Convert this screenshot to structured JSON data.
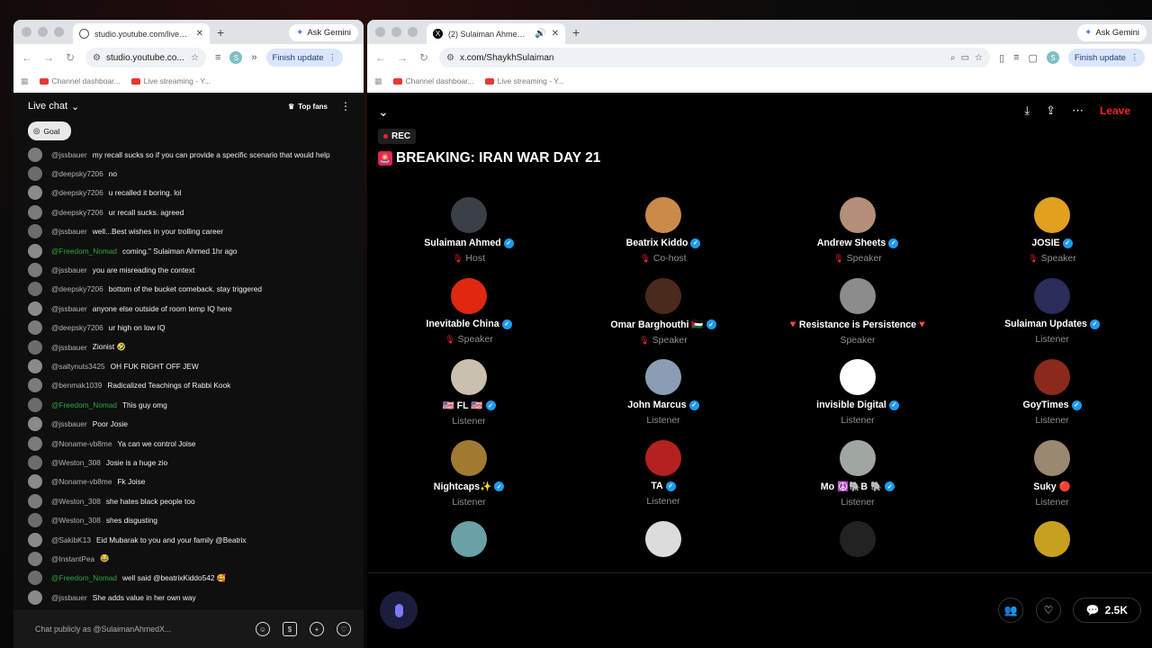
{
  "left_window": {
    "tab_title": "studio.youtube.com/live_chat",
    "gemini": "Ask Gemini",
    "url": "studio.youtube.co...",
    "finish_update": "Finish update",
    "bookmarks": [
      "Channel dashboar...",
      "Live streaming - Y..."
    ],
    "chat": {
      "title": "Live chat",
      "top_fans": "Top fans",
      "goal": "Goal",
      "input_placeholder": "Chat publicly as @SulaimanAhmedX...",
      "messages": [
        {
          "author": "@jssbauer",
          "text": "my recall sucks so if you can provide a specific scenario that would help",
          "member": false
        },
        {
          "author": "@deepsky7206",
          "text": "no",
          "member": false
        },
        {
          "author": "@deepsky7206",
          "text": "u recalled it boring. lol",
          "member": false
        },
        {
          "author": "@deepsky7206",
          "text": "ur recall sucks. agreed",
          "member": false
        },
        {
          "author": "@jssbauer",
          "text": "well...Best wishes in your trolling career",
          "member": false
        },
        {
          "author": "@Freedom_Nomad",
          "text": "coming.\" Sulaiman Ahmed 1hr ago",
          "member": true
        },
        {
          "author": "@jssbauer",
          "text": "you are misreading the context",
          "member": false
        },
        {
          "author": "@deepsky7206",
          "text": "bottom of the bucket comeback. stay triggered",
          "member": false
        },
        {
          "author": "@jssbauer",
          "text": "anyone else outside of room temp IQ here",
          "member": false
        },
        {
          "author": "@deepsky7206",
          "text": "ur high on low IQ",
          "member": false
        },
        {
          "author": "@jssbauer",
          "text": "Zionist 🤣",
          "member": false
        },
        {
          "author": "@saltynuts3425",
          "text": "OH FUK RIGHT OFF JEW",
          "member": false
        },
        {
          "author": "@benmak1039",
          "text": "Radicalized Teachings of Rabbi Kook",
          "member": false
        },
        {
          "author": "@Freedom_Nomad",
          "text": "This guy omg",
          "member": true
        },
        {
          "author": "@jssbauer",
          "text": "Poor Josie",
          "member": false
        },
        {
          "author": "@Noname-vb8me",
          "text": "Ya can we control Joise",
          "member": false
        },
        {
          "author": "@Weston_308",
          "text": "Josie is a huge zio",
          "member": false
        },
        {
          "author": "@Noname-vb8me",
          "text": "Fk Joise",
          "member": false
        },
        {
          "author": "@Weston_308",
          "text": "she hates black people too",
          "member": false
        },
        {
          "author": "@Weston_308",
          "text": "shes disgusting",
          "member": false
        },
        {
          "author": "@SakibK13",
          "text": "Eid Mubarak to you and your family @Beatrix",
          "member": false
        },
        {
          "author": "@InstantPea",
          "text": "😂",
          "member": false
        },
        {
          "author": "@Freedom_Nomad",
          "text": "well said @beatrixKiddo542 🥰",
          "member": true
        },
        {
          "author": "@jssbauer",
          "text": "She adds value in her own way",
          "member": false
        }
      ]
    }
  },
  "right_window": {
    "tab_title": "(2) Sulaiman Ahmed (@S...",
    "gemini": "Ask Gemini",
    "url": "x.com/ShaykhSulaiman",
    "finish_update": "Finish update",
    "bookmarks": [
      "Channel dashboar...",
      "Live streaming - Y..."
    ],
    "space": {
      "leave": "Leave",
      "rec": "REC",
      "title": "BREAKING: IRAN WAR DAY 21",
      "replies": "2.5K",
      "participants": [
        {
          "name": "Sulaiman Ahmed",
          "role": "Host",
          "verified": true,
          "muted": true,
          "color": "#3a3f48"
        },
        {
          "name": "Beatrix Kiddo",
          "role": "Co-host",
          "verified": true,
          "muted": true,
          "color": "#c98a4a"
        },
        {
          "name": "Andrew Sheets",
          "role": "Speaker",
          "verified": true,
          "muted": true,
          "color": "#b48f7a"
        },
        {
          "name": "JOSIE",
          "role": "Speaker",
          "verified": true,
          "muted": true,
          "color": "#e0a020"
        },
        {
          "name": "Inevitable China",
          "role": "Speaker",
          "verified": true,
          "muted": true,
          "color": "#de2910"
        },
        {
          "name": "Omar Barghouthi 🇵🇸",
          "role": "Speaker",
          "verified": true,
          "muted": true,
          "color": "#4a2a1a"
        },
        {
          "name": "🔻Resistance is Persistence🔻",
          "role": "Speaker",
          "verified": false,
          "muted": false,
          "color": "#8c8c8c"
        },
        {
          "name": "Sulaiman Updates",
          "role": "Listener",
          "verified": true,
          "muted": false,
          "color": "#2a2d5a"
        },
        {
          "name": "🇺🇸 FL 🇺🇸",
          "role": "Listener",
          "verified": true,
          "muted": false,
          "color": "#c9c0b0"
        },
        {
          "name": "John Marcus",
          "role": "Listener",
          "verified": true,
          "muted": false,
          "color": "#8a9db5"
        },
        {
          "name": "invisible Digital",
          "role": "Listener",
          "verified": true,
          "muted": false,
          "color": "#ffffff"
        },
        {
          "name": "GoyTimes",
          "role": "Listener",
          "verified": true,
          "muted": false,
          "color": "#8a2a1a"
        },
        {
          "name": "Nightcaps✨",
          "role": "Listener",
          "verified": true,
          "muted": false,
          "color": "#a07a30"
        },
        {
          "name": "TA",
          "role": "Listener",
          "verified": true,
          "muted": false,
          "color": "#b52020"
        },
        {
          "name": "Mo ☮️🐘B 🐘",
          "role": "Listener",
          "verified": true,
          "muted": false,
          "color": "#9fa7a0"
        },
        {
          "name": "Suky 🔴",
          "role": "Listener",
          "verified": false,
          "muted": false,
          "color": "#9b8870"
        },
        {
          "name": "",
          "role": "",
          "verified": false,
          "muted": false,
          "color": "#6aa0a8"
        },
        {
          "name": "",
          "role": "",
          "verified": false,
          "muted": false,
          "color": "#dcdcdc"
        },
        {
          "name": "",
          "role": "",
          "verified": false,
          "muted": false,
          "color": "#222222"
        },
        {
          "name": "",
          "role": "",
          "verified": false,
          "muted": false,
          "color": "#c8a020"
        }
      ]
    }
  }
}
